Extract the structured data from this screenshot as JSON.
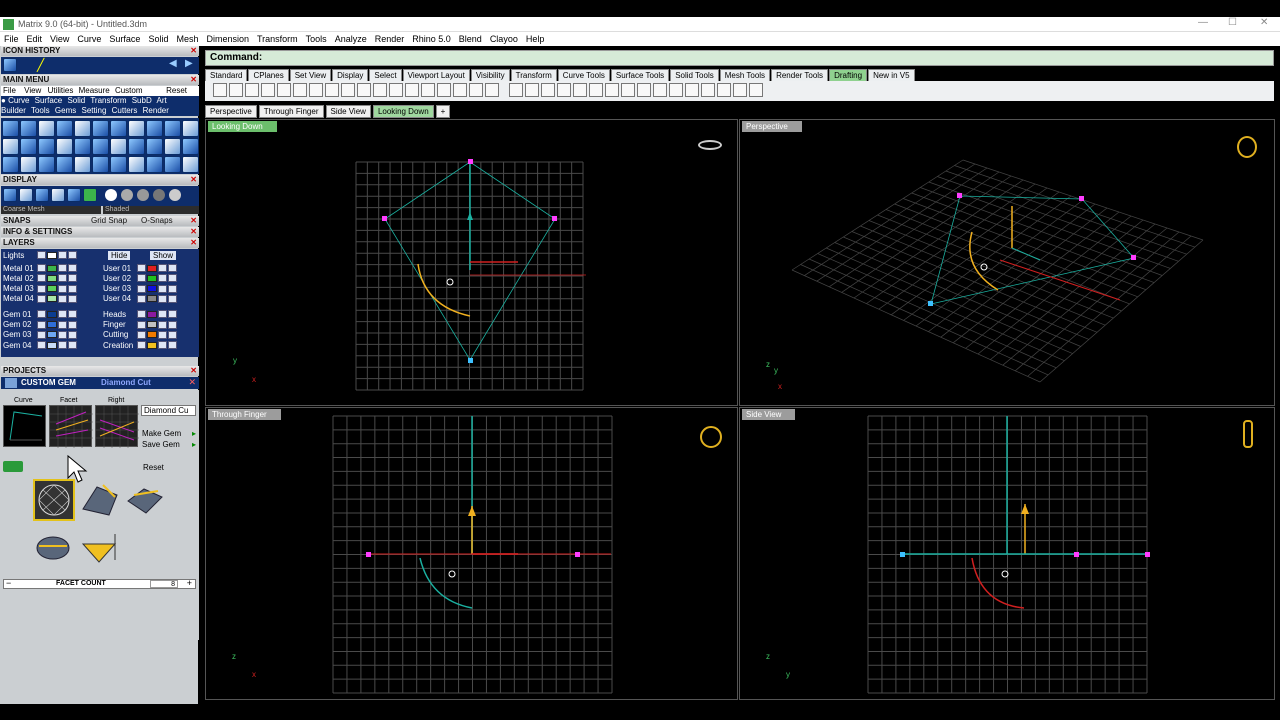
{
  "app": {
    "title": "Matrix 9.0 (64-bit) - Untitled.3dm"
  },
  "menu": [
    "File",
    "Edit",
    "View",
    "Curve",
    "Surface",
    "Solid",
    "Mesh",
    "Dimension",
    "Transform",
    "Tools",
    "Analyze",
    "Render",
    "Rhino 5.0",
    "Blend",
    "Clayoo",
    "Help"
  ],
  "sidebar": {
    "icon_history": "ICON HISTORY",
    "main_menu": "MAIN MENU",
    "mm_tabs": [
      "File",
      "View",
      "Utilities",
      "Measure",
      "Custom"
    ],
    "mm_reset": "Reset",
    "mm_row1": [
      "Curve",
      "Surface",
      "Solid",
      "Transform",
      "SubD",
      "Art"
    ],
    "mm_row2": [
      "Builder",
      "Tools",
      "Gems",
      "Setting",
      "Cutters",
      "Render"
    ],
    "display": "DISPLAY",
    "display_opt1": "Coarse Mesh",
    "display_opt2": "Shaded",
    "snaps": "SNAPS",
    "grid_snap": "Grid Snap",
    "osnaps": "O-Snaps",
    "info": "INFO & SETTINGS",
    "layers": "LAYERS",
    "lights": "Lights",
    "hide": "Hide",
    "show": "Show",
    "layers_left": [
      {
        "name": "Metal 01",
        "color": "#3cb44b"
      },
      {
        "name": "Metal 02",
        "color": "#7fdc7f"
      },
      {
        "name": "Metal 03",
        "color": "#5ad15a"
      },
      {
        "name": "Metal 04",
        "color": "#a8e6a8"
      },
      {
        "name": "Gem 01",
        "color": "#0b3d91"
      },
      {
        "name": "Gem 02",
        "color": "#2f6ed8"
      },
      {
        "name": "Gem 03",
        "color": "#6fa8f2"
      },
      {
        "name": "Gem 04",
        "color": "#c7dbf7"
      }
    ],
    "layers_right": [
      {
        "name": "User 01",
        "color": "#e02020"
      },
      {
        "name": "User 02",
        "color": "#20c020"
      },
      {
        "name": "User 03",
        "color": "#1010e0"
      },
      {
        "name": "User 04",
        "color": "#888888"
      },
      {
        "name": "Heads",
        "color": "#8a1aa0"
      },
      {
        "name": "Finger",
        "color": "#c0c0c0"
      },
      {
        "name": "Cutting",
        "color": "#f07a00"
      },
      {
        "name": "Creation",
        "color": "#f0c020"
      }
    ],
    "projects": "PROJECTS",
    "custom_gem": "CUSTOM GEM",
    "gem_name": "Diamond Cut",
    "thumb_labels": [
      "Curve",
      "Facet",
      "Right"
    ],
    "gem_input": "Diamond Cu",
    "make_gem": "Make Gem",
    "save_gem": "Save Gem",
    "reset": "Reset",
    "facet_count_label": "FACET COUNT",
    "facet_count": "8"
  },
  "command": {
    "label": "Command:"
  },
  "toolbar_tabs": [
    "Standard",
    "CPlanes",
    "Set View",
    "Display",
    "Select",
    "Viewport Layout",
    "Visibility",
    "Transform",
    "Curve Tools",
    "Surface Tools",
    "Solid Tools",
    "Mesh Tools",
    "Render Tools",
    "Drafting",
    "New in V5"
  ],
  "active_toolbar_tab": "Drafting",
  "viewport_tabs": [
    "Perspective",
    "Through Finger",
    "Side View",
    "Looking Down"
  ],
  "viewports": {
    "top_left": "Looking Down",
    "top_right": "Perspective",
    "bottom_left": "Through Finger",
    "bottom_right": "Side View"
  },
  "axes": {
    "tl_y": "y",
    "tl_x": "x",
    "tr_z": "z",
    "tr_x": "x",
    "tr_y": "y",
    "bl_z": "z",
    "bl_x": "x",
    "br_z": "z",
    "br_y": "y"
  },
  "colors": {
    "grid": "#4a4a4a",
    "cyan": "#1bb0a0",
    "magenta": "#ff3dff",
    "yellow": "#f0b020",
    "red": "#d02020"
  }
}
